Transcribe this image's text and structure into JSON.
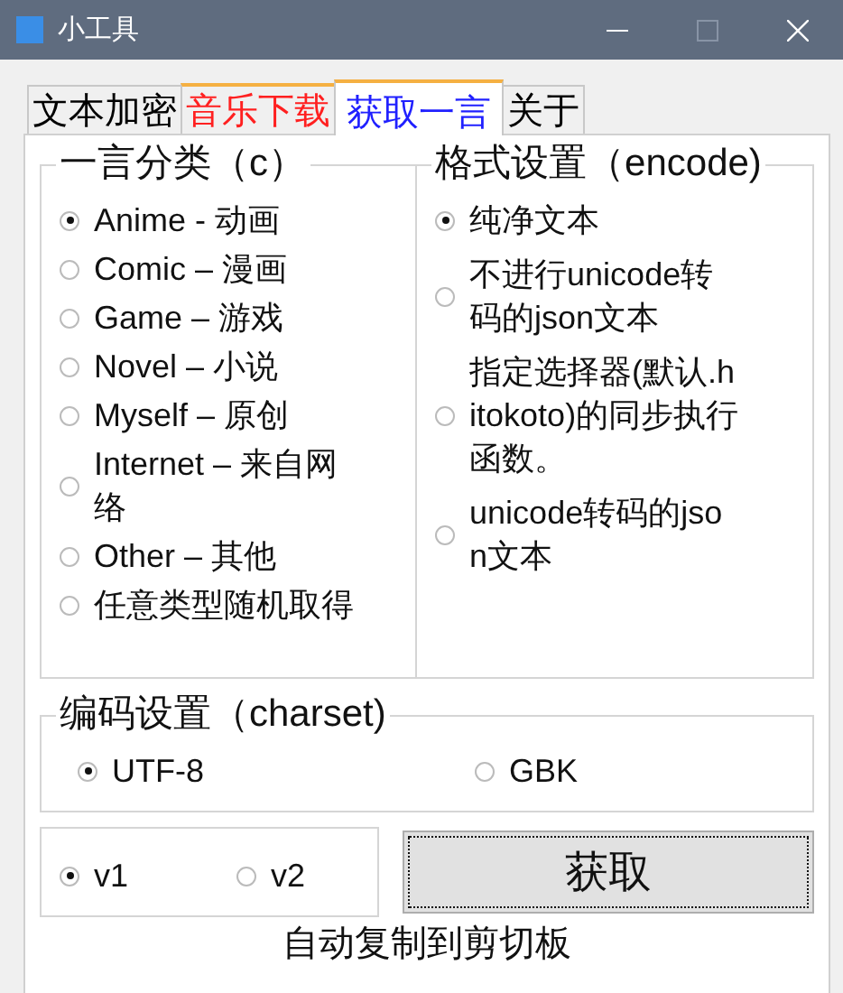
{
  "window": {
    "title": "小工具"
  },
  "tabs": [
    {
      "label": "文本加密",
      "selected": false,
      "highlighted": false,
      "color": "#000000"
    },
    {
      "label": "音乐下载",
      "selected": false,
      "highlighted": true,
      "color": "#ff2020"
    },
    {
      "label": "获取一言",
      "selected": true,
      "highlighted": true,
      "color": "#2020ff"
    },
    {
      "label": "关于",
      "selected": false,
      "highlighted": false,
      "color": "#000000"
    }
  ],
  "category_group": {
    "title": "一言分类（c）",
    "options": [
      {
        "label": "Anime - 动画",
        "selected": true
      },
      {
        "label": "Comic – 漫画",
        "selected": false
      },
      {
        "label": "Game – 游戏",
        "selected": false
      },
      {
        "label": "Novel – 小说",
        "selected": false
      },
      {
        "label": "Myself – 原创",
        "selected": false
      },
      {
        "label": "Internet – 来自网络",
        "selected": false
      },
      {
        "label": "Other – 其他",
        "selected": false
      },
      {
        "label": "任意类型随机取得",
        "selected": false
      }
    ]
  },
  "encode_group": {
    "title": "格式设置（encode)",
    "options": [
      {
        "label": "纯净文本",
        "selected": true
      },
      {
        "label": "不进行unicode转码的json文本",
        "selected": false
      },
      {
        "label": "指定选择器(默认.hitokoto)的同步执行函数。",
        "selected": false
      },
      {
        "label": "unicode转码的json文本",
        "selected": false
      }
    ]
  },
  "charset_group": {
    "title": "编码设置（charset)",
    "options": [
      {
        "label": "UTF-8",
        "selected": true
      },
      {
        "label": "GBK",
        "selected": false
      }
    ]
  },
  "version_group": {
    "options": [
      {
        "label": "v1",
        "selected": true
      },
      {
        "label": "v2",
        "selected": false
      }
    ]
  },
  "fetch_button": {
    "label": "获取",
    "focused": true
  },
  "footer_text": "自动复制到剪切板"
}
